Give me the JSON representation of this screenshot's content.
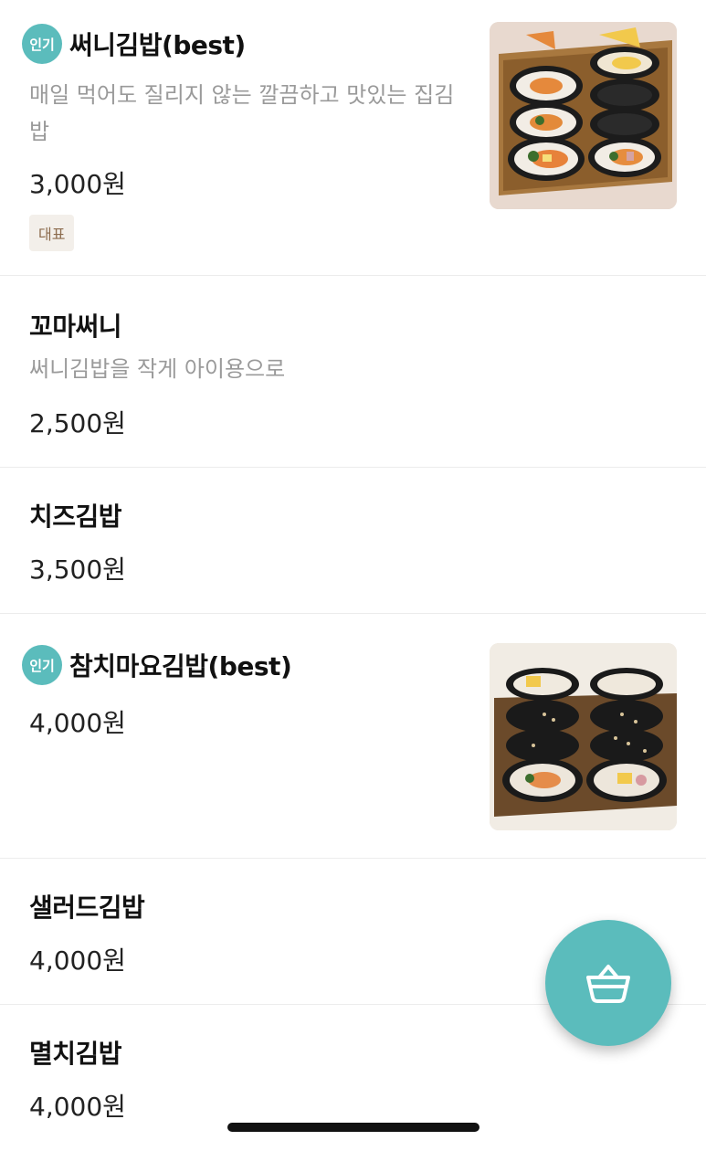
{
  "menu": {
    "items": [
      {
        "popular_badge": "인기",
        "name": "써니김밥(best)",
        "description": "매일 먹어도 질리지 않는 깔끔하고 맛있는 집김밥",
        "price": "3,000원",
        "tag": "대표"
      },
      {
        "name": "꼬마써니",
        "description": "써니김밥을 작게 아이용으로",
        "price": "2,500원"
      },
      {
        "name": "치즈김밥",
        "price": "3,500원"
      },
      {
        "popular_badge": "인기",
        "name": "참치마요김밥(best)",
        "price": "4,000원"
      },
      {
        "name": "샐러드김밥",
        "price": "4,000원"
      },
      {
        "name": "멸치김밥",
        "price": "4,000원"
      }
    ]
  },
  "cart_button": {
    "icon": "shopping-basket-icon"
  },
  "colors": {
    "accent": "#5bbcbc",
    "tag_bg": "#f3efea",
    "tag_text": "#8c6b4d",
    "description": "#9a9a9a"
  }
}
